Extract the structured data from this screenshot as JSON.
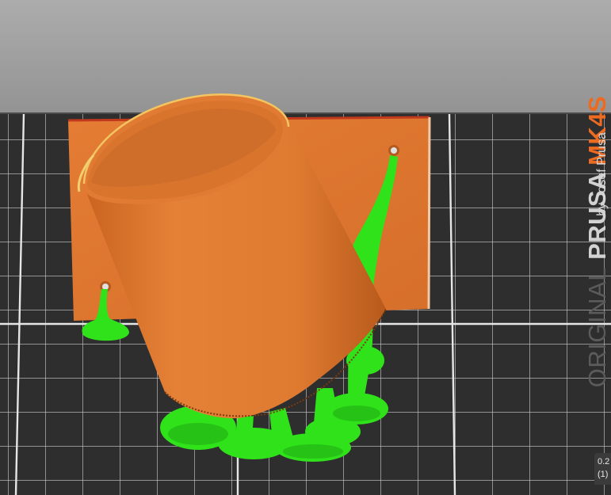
{
  "bed_label": {
    "original": "ORIGINAL",
    "prusa": "PRUSA",
    "model": "MK4S",
    "byline": "by Josef Prusa"
  },
  "layer_info": {
    "height": "0.2",
    "count": "(1)"
  },
  "colors": {
    "background_top": "#a9a9a9",
    "background_bottom": "#8f8f8f",
    "bed_surface": "#2e2e2e",
    "bed_grid": "#d8d8d8",
    "model_orange": "#e07a32",
    "model_orange_shadow": "#c96426",
    "support_green": "#2fe21a",
    "support_green_shadow": "#1fa812",
    "brand_accent": "#ed6b21"
  },
  "scene": {
    "object": "cylindrical cup on rectangular plate",
    "supports": "tree supports"
  }
}
